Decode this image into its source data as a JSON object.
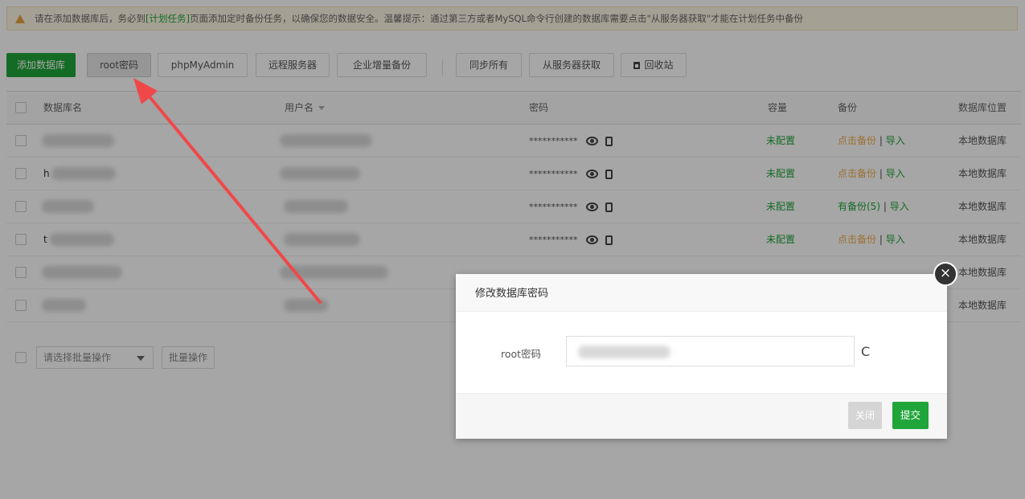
{
  "notice": {
    "prefix": "请在添加数据库后，务必到",
    "link": "[计划任务]",
    "suffix": "页面添加定时备份任务，以确保您的数据安全。温馨提示：通过第三方或者MySQL命令行创建的数据库需要点击\"从服务器获取\"才能在计划任务中备份"
  },
  "toolbar": {
    "add_db": "添加数据库",
    "root_pwd": "root密码",
    "phpmyadmin": "phpMyAdmin",
    "remote": "远程服务器",
    "enterprise_backup": "企业增量备份",
    "sync_all": "同步所有",
    "fetch_from_server": "从服务器获取",
    "recycle_bin": "回收站"
  },
  "table": {
    "headers": {
      "name": "数据库名",
      "user": "用户名",
      "password": "密码",
      "capacity": "容量",
      "backup": "备份",
      "location": "数据库位置"
    },
    "rows": [
      {
        "name_prefix": "",
        "password_mask": "***********",
        "capacity": "未配置",
        "backup_action": "点击备份",
        "backup_sep": "|",
        "import": "导入",
        "location": "本地数据库"
      },
      {
        "name_prefix": "h",
        "password_mask": "***********",
        "capacity": "未配置",
        "backup_action": "点击备份",
        "backup_sep": "|",
        "import": "导入",
        "location": "本地数据库"
      },
      {
        "name_prefix": "",
        "password_mask": "***********",
        "capacity": "未配置",
        "backup_action": "有备份(5)",
        "backup_sep": "|",
        "import": "导入",
        "location": "本地数据库"
      },
      {
        "name_prefix": "t",
        "password_mask": "***********",
        "capacity": "未配置",
        "backup_action": "点击备份",
        "backup_sep": "|",
        "import": "导入",
        "location": "本地数据库"
      },
      {
        "name_prefix": "",
        "password_mask": "",
        "capacity": "",
        "backup_action": "",
        "backup_sep": "",
        "import": "",
        "location": "本地数据库"
      },
      {
        "name_prefix": "",
        "password_mask": "",
        "capacity": "",
        "backup_action": "",
        "backup_sep": "",
        "import": "",
        "location": "本地数据库"
      }
    ]
  },
  "batch": {
    "select_placeholder": "请选择批量操作",
    "button": "批量操作"
  },
  "dialog": {
    "title": "修改数据库密码",
    "label": "root密码",
    "refresh_glyph": "C",
    "close_label": "关闭",
    "submit_label": "提交",
    "x_glyph": "×"
  },
  "colors": {
    "accent": "#20a53a",
    "warning": "#f0ad4e",
    "arrow": "#f04848"
  },
  "icons": {
    "notice": "warning-triangle-icon",
    "recycle": "trash-icon",
    "password_view": "eye-icon",
    "password_copy": "copy-icon",
    "refresh": "refresh-icon",
    "close": "close-circle-icon"
  }
}
